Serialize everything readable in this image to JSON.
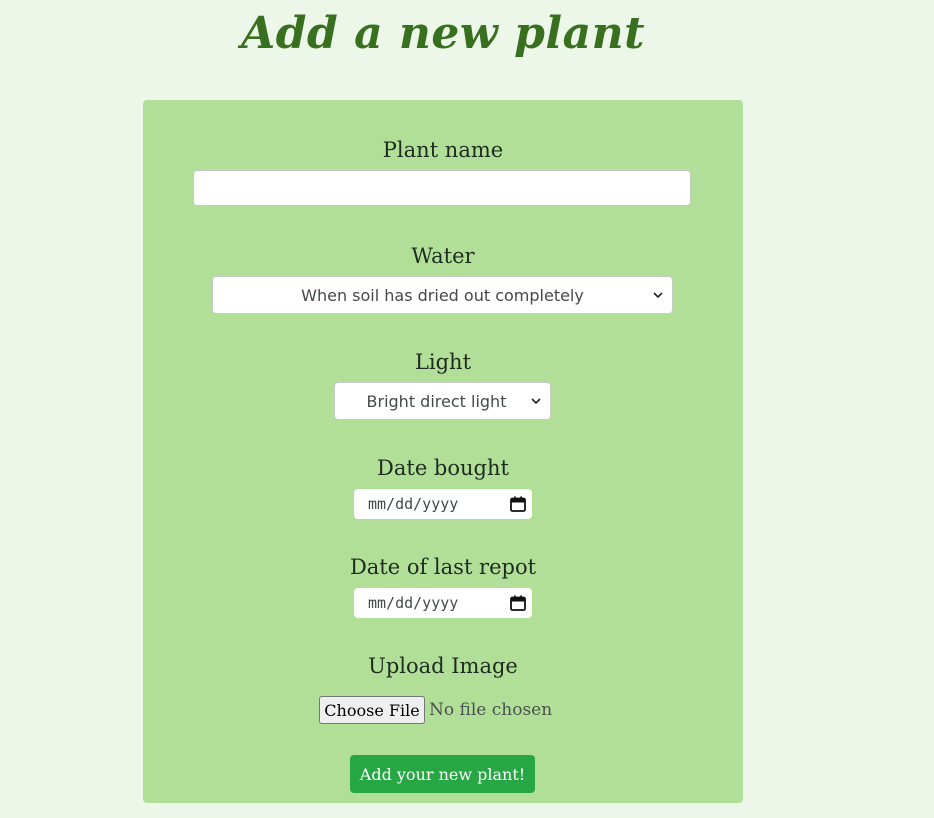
{
  "page": {
    "title": "Add a new plant"
  },
  "form": {
    "plant_name": {
      "label": "Plant name",
      "value": ""
    },
    "water": {
      "label": "Water",
      "selected": "When soil has dried out completely"
    },
    "light": {
      "label": "Light",
      "selected": "Bright direct light"
    },
    "date_bought": {
      "label": "Date bought",
      "placeholder": "mm/dd/yyyy"
    },
    "date_last_repot": {
      "label": "Date of last repot",
      "placeholder": "mm/dd/yyyy"
    },
    "upload_image": {
      "label": "Upload Image",
      "button_label": "Choose File",
      "status": "No file chosen"
    },
    "submit_label": "Add your new plant!"
  },
  "icons": {
    "select_arrow": "chevron-down-icon",
    "date_picker": "calendar-icon"
  },
  "colors": {
    "background": "#ecf7e9",
    "title": "#38701f",
    "card": "#b1df98",
    "submit_button": "#27a644"
  }
}
